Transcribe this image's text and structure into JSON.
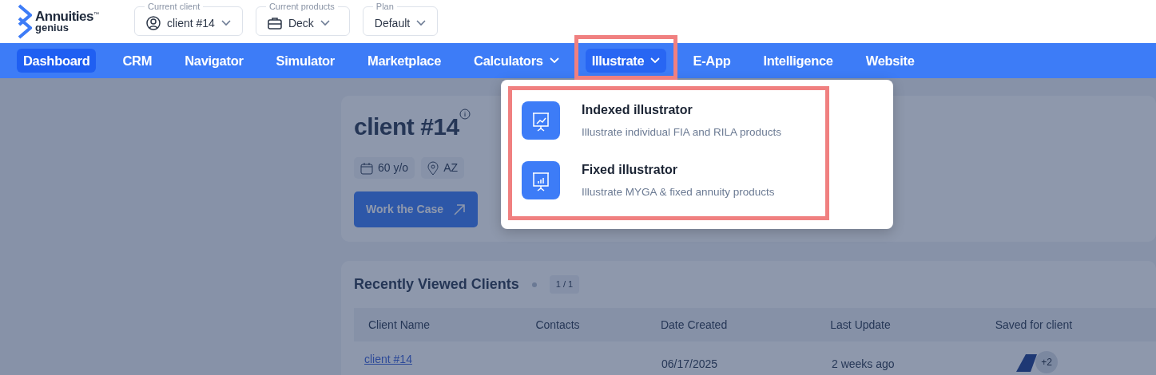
{
  "brand": {
    "name": "Annuities",
    "trademark": "™",
    "sub": "genius"
  },
  "selectors": [
    {
      "label": "Current client",
      "value": "client #14",
      "kind": "person"
    },
    {
      "label": "Current products",
      "value": "Deck",
      "kind": "briefcase"
    },
    {
      "label": "Plan",
      "value": "Default",
      "kind": "plain"
    }
  ],
  "nav": [
    {
      "label": "Dashboard",
      "selected": true,
      "dropdown": false,
      "expanded": false
    },
    {
      "label": "CRM",
      "selected": false,
      "dropdown": false,
      "expanded": false
    },
    {
      "label": "Navigator",
      "selected": false,
      "dropdown": false,
      "expanded": false
    },
    {
      "label": "Simulator",
      "selected": false,
      "dropdown": false,
      "expanded": false
    },
    {
      "label": "Marketplace",
      "selected": false,
      "dropdown": false,
      "expanded": false
    },
    {
      "label": "Calculators",
      "selected": false,
      "dropdown": true,
      "expanded": false
    },
    {
      "label": "Illustrate",
      "selected": false,
      "dropdown": true,
      "expanded": true
    },
    {
      "label": "E-App",
      "selected": false,
      "dropdown": false,
      "expanded": false
    },
    {
      "label": "Intelligence",
      "selected": false,
      "dropdown": false,
      "expanded": false
    },
    {
      "label": "Website",
      "selected": false,
      "dropdown": false,
      "expanded": false
    }
  ],
  "menu": [
    {
      "title": "Indexed illustrator",
      "subtitle": "Illustrate individual FIA and RILA products",
      "kind": "line"
    },
    {
      "title": "Fixed illustrator",
      "subtitle": "Illustrate MYGA & fixed annuity products",
      "kind": "bars"
    }
  ],
  "client_card": {
    "name": "client #14",
    "age": "60 y/o",
    "state": "AZ",
    "button": "Work the Case"
  },
  "recent": {
    "title": "Recently Viewed Clients",
    "pages": "1 / 1",
    "columns": [
      "Client Name",
      "Contacts",
      "Date Created",
      "Last Update",
      "Saved for client"
    ],
    "rows": [
      {
        "name": "client #14",
        "created": "06/17/2025",
        "updated": "2 weeks ago",
        "extra": "+2"
      }
    ]
  }
}
